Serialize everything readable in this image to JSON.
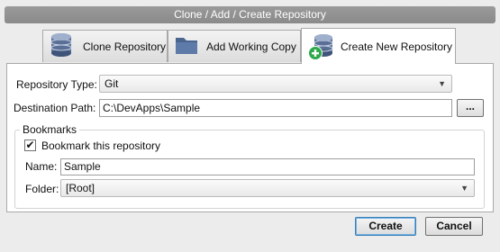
{
  "window": {
    "title": "Clone  / Add / Create Repository"
  },
  "tabs": [
    {
      "label": "Clone Repository",
      "icon": "database-icon"
    },
    {
      "label": "Add Working Copy",
      "icon": "folder-icon"
    },
    {
      "label": "Create New Repository",
      "icon": "database-add-icon",
      "active": true
    }
  ],
  "form": {
    "repo_type_label": "Repository Type:",
    "repo_type_value": "Git",
    "dest_label": "Destination Path:",
    "dest_value": "C:\\DevApps\\Sample",
    "browse_label": "...",
    "bookmarks_group": "Bookmarks",
    "bookmark_check_label": "Bookmark this repository",
    "bookmark_checked": true,
    "name_label": "Name:",
    "name_value": "Sample",
    "folder_label": "Folder:",
    "folder_value": "[Root]"
  },
  "buttons": {
    "create": "Create",
    "cancel": "Cancel"
  },
  "colors": {
    "title_bar": "#8e8e8e",
    "add_badge": "#2da84a",
    "folder": "#4a6690",
    "db": "#5a6f96"
  }
}
